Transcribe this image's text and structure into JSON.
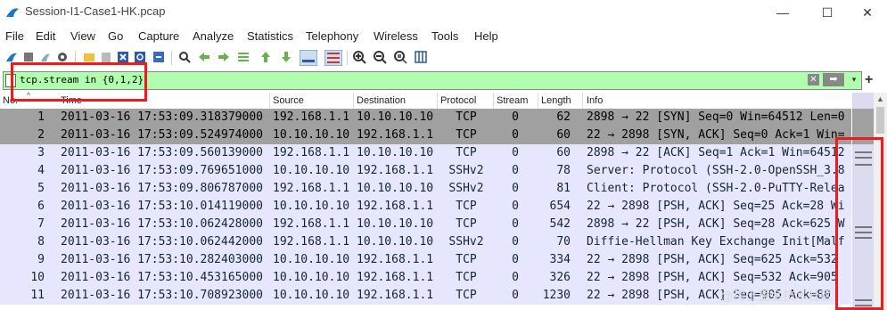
{
  "window": {
    "title": "Session-I1-Case1-HK.pcap",
    "controls": {
      "minimize": "—",
      "maximize": "☐",
      "close": "✕"
    }
  },
  "menu": [
    "File",
    "Edit",
    "View",
    "Go",
    "Capture",
    "Analyze",
    "Statistics",
    "Telephony",
    "Wireless",
    "Tools",
    "Help"
  ],
  "toolbar": {
    "icons": [
      "shark-fin-start-icon",
      "stop-icon",
      "restart-icon",
      "options-icon",
      "open-file-icon",
      "save-icon",
      "close-file-icon",
      "reload-icon",
      "find-icon",
      "back-icon",
      "forward-icon",
      "goto-icon",
      "first-packet-icon",
      "last-packet-icon",
      "autoscroll-icon",
      "colorize-icon",
      "zoom-in-icon",
      "zoom-out-icon",
      "normal-size-icon",
      "resize-columns-icon"
    ]
  },
  "filter": {
    "value": "tcp.stream in {0,1,2}",
    "clear_label": "✕",
    "apply_label": "➡",
    "dropdown_label": "▾",
    "add_label": "+"
  },
  "columns": [
    "No.",
    "Time",
    "Source",
    "Destination",
    "Protocol",
    "Stream",
    "Length",
    "Info"
  ],
  "packets": [
    {
      "no": "1",
      "time": "2011-03-16 17:53:09.318379000",
      "src": "192.168.1.1",
      "dst": "10.10.10.10",
      "proto": "TCP",
      "stream": "0",
      "len": "62",
      "info": "2898 → 22 [SYN] Seq=0 Win=64512 Len=0",
      "style": "sel"
    },
    {
      "no": "2",
      "time": "2011-03-16 17:53:09.524974000",
      "src": "10.10.10.10",
      "dst": "192.168.1.1",
      "proto": "TCP",
      "stream": "0",
      "len": "60",
      "info": "22 → 2898 [SYN, ACK] Seq=0 Ack=1 Win=",
      "style": "sel"
    },
    {
      "no": "3",
      "time": "2011-03-16 17:53:09.560139000",
      "src": "192.168.1.1",
      "dst": "10.10.10.10",
      "proto": "TCP",
      "stream": "0",
      "len": "60",
      "info": "2898 → 22 [ACK] Seq=1 Ack=1 Win=64512",
      "style": "norm"
    },
    {
      "no": "4",
      "time": "2011-03-16 17:53:09.769651000",
      "src": "10.10.10.10",
      "dst": "192.168.1.1",
      "proto": "SSHv2",
      "stream": "0",
      "len": "78",
      "info": "Server: Protocol (SSH-2.0-OpenSSH_3.8",
      "style": "norm"
    },
    {
      "no": "5",
      "time": "2011-03-16 17:53:09.806787000",
      "src": "192.168.1.1",
      "dst": "10.10.10.10",
      "proto": "SSHv2",
      "stream": "0",
      "len": "81",
      "info": "Client: Protocol (SSH-2.0-PuTTY-Relea",
      "style": "norm"
    },
    {
      "no": "6",
      "time": "2011-03-16 17:53:10.014119000",
      "src": "10.10.10.10",
      "dst": "192.168.1.1",
      "proto": "TCP",
      "stream": "0",
      "len": "654",
      "info": "22 → 2898 [PSH, ACK] Seq=25 Ack=28 Wi",
      "style": "norm"
    },
    {
      "no": "7",
      "time": "2011-03-16 17:53:10.062428000",
      "src": "192.168.1.1",
      "dst": "10.10.10.10",
      "proto": "TCP",
      "stream": "0",
      "len": "542",
      "info": "2898 → 22 [PSH, ACK] Seq=28 Ack=625 W",
      "style": "norm"
    },
    {
      "no": "8",
      "time": "2011-03-16 17:53:10.062442000",
      "src": "192.168.1.1",
      "dst": "10.10.10.10",
      "proto": "SSHv2",
      "stream": "0",
      "len": "70",
      "info": "Diffie-Hellman Key Exchange Init[Malf",
      "style": "norm"
    },
    {
      "no": "9",
      "time": "2011-03-16 17:53:10.282403000",
      "src": "10.10.10.10",
      "dst": "192.168.1.1",
      "proto": "TCP",
      "stream": "0",
      "len": "334",
      "info": "22 → 2898 [PSH, ACK] Seq=625 Ack=532",
      "style": "norm"
    },
    {
      "no": "10",
      "time": "2011-03-16 17:53:10.453165000",
      "src": "10.10.10.10",
      "dst": "192.168.1.1",
      "proto": "TCP",
      "stream": "0",
      "len": "326",
      "info": "22 → 2898 [PSH, ACK] Seq=532 Ack=905",
      "style": "norm"
    },
    {
      "no": "11",
      "time": "2011-03-16 17:53:10.708923000",
      "src": "10.10.10.10",
      "dst": "192.168.1.1",
      "proto": "TCP",
      "stream": "0",
      "len": "1230",
      "info": "22 → 2898 [PSH, ACK] Seq=905 Ack=80",
      "style": "norm"
    }
  ],
  "colors": {
    "filter_valid": "#afffaf",
    "row_selected": "#a0a0a0",
    "row_tcp": "#e7e6ff",
    "annotation_red": "#ef1a1a"
  },
  "watermark": "@稀土掘金技术社区"
}
